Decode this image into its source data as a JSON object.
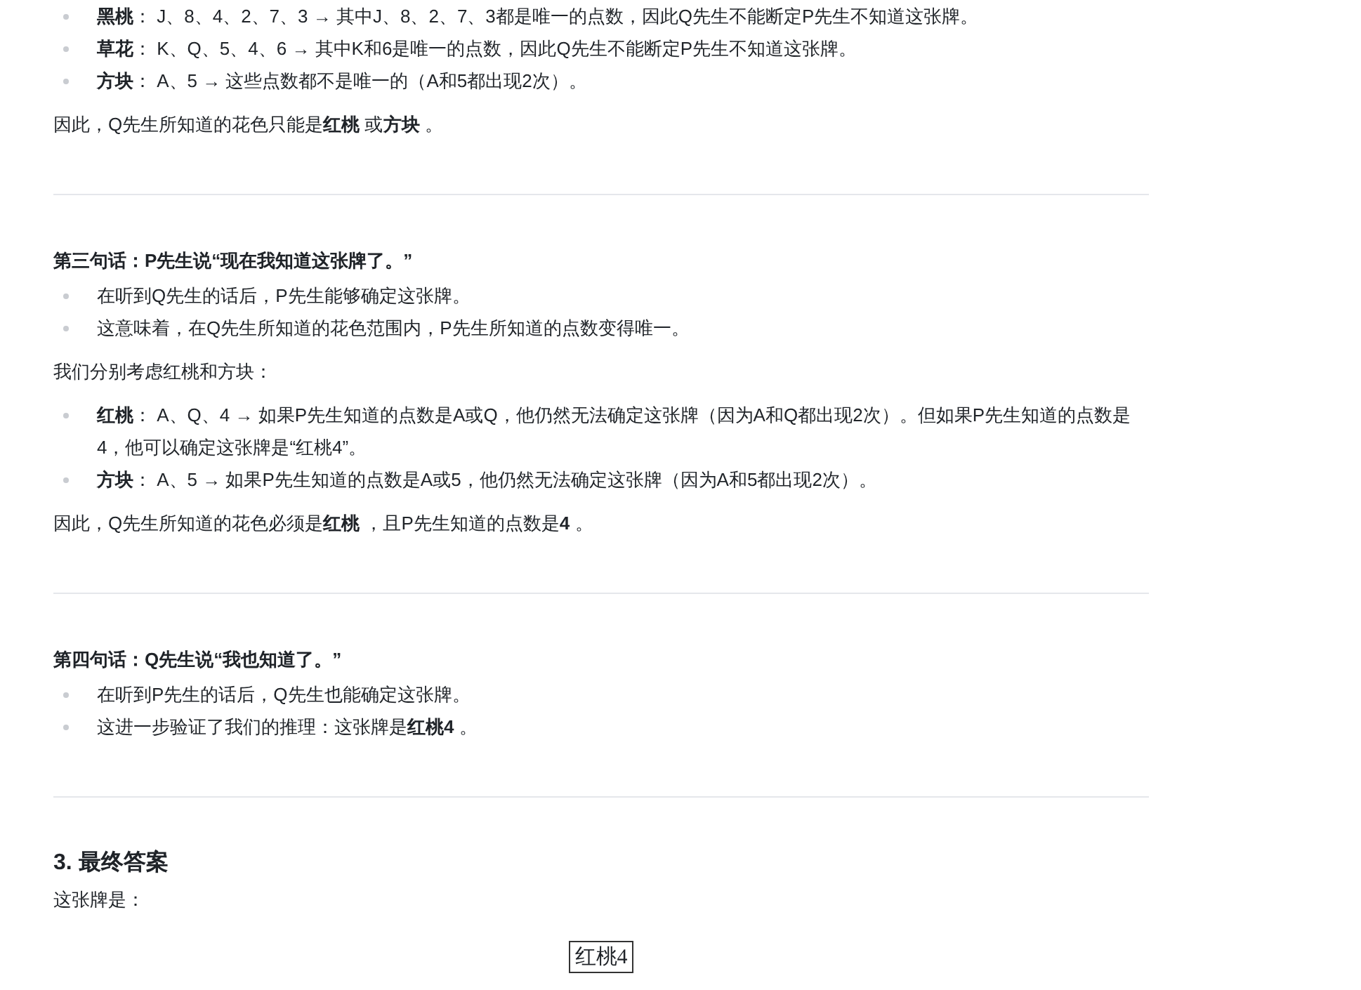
{
  "blocks": [
    {
      "kind": "bullets",
      "items": [
        "**黑桃**： J、8、4、2、7、3 → 其中J、8、2、7、3都是唯一的点数，因此Q先生不能断定P先生不知道这张牌。",
        "**草花**： K、Q、5、4、6 → 其中K和6是唯一的点数，因此Q先生不能断定P先生不知道这张牌。",
        "**方块**： A、5 → 这些点数都不是唯一的（A和5都出现2次）。"
      ]
    },
    {
      "kind": "para",
      "text": "因此，Q先生所知道的花色只能是**红桃** 或**方块** 。"
    },
    {
      "kind": "rule"
    },
    {
      "kind": "subheading",
      "text": "第三句话：P先生说“现在我知道这张牌了。”"
    },
    {
      "kind": "bullets",
      "items": [
        "在听到Q先生的话后，P先生能够确定这张牌。",
        "这意味着，在Q先生所知道的花色范围内，P先生所知道的点数变得唯一。"
      ]
    },
    {
      "kind": "para",
      "text": "我们分别考虑红桃和方块："
    },
    {
      "kind": "bullets",
      "items": [
        "**红桃**： A、Q、4 → 如果P先生知道的点数是A或Q，他仍然无法确定这张牌（因为A和Q都出现2次）。但如果P先生知道的点数是4，他可以确定这张牌是“红桃4”。",
        "**方块**： A、5 → 如果P先生知道的点数是A或5，他仍然无法确定这张牌（因为A和5都出现2次）。"
      ]
    },
    {
      "kind": "para",
      "text": "因此，Q先生所知道的花色必须是**红桃** ，且P先生知道的点数是**4** 。"
    },
    {
      "kind": "rule"
    },
    {
      "kind": "subheading",
      "text": "第四句话：Q先生说“我也知道了。”"
    },
    {
      "kind": "bullets",
      "items": [
        "在听到P先生的话后，Q先生也能确定这张牌。",
        "这进一步验证了我们的推理：这张牌是**红桃4** 。"
      ]
    },
    {
      "kind": "rule"
    },
    {
      "kind": "heading",
      "text": "3. 最终答案"
    },
    {
      "kind": "para",
      "text": "这张牌是："
    },
    {
      "kind": "answer",
      "text": "红桃4"
    }
  ]
}
